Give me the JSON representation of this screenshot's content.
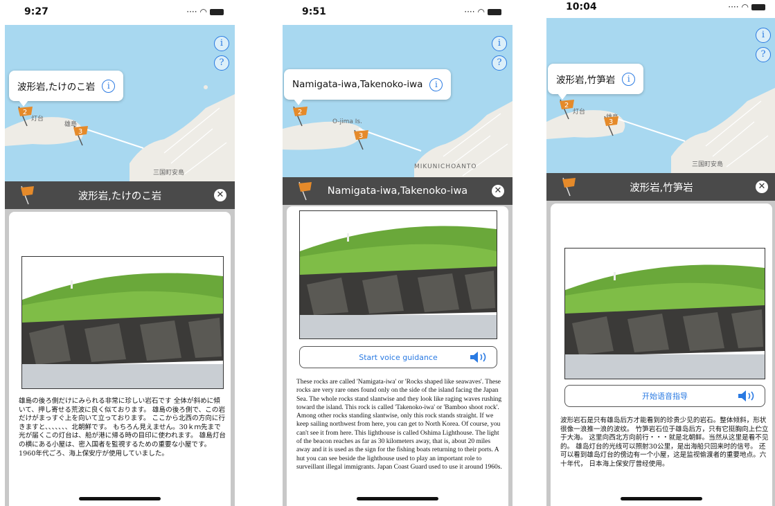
{
  "colors": {
    "water": "#a8d8f0",
    "land": "#eeece6",
    "accent": "#2a7ae2",
    "flag": "#e58a2a",
    "titlebar": "#4a4a4a"
  },
  "icons": {
    "info": "info-circle-icon",
    "help": "question-circle-icon",
    "close": "close-circle-icon",
    "speaker": "speaker-icon",
    "flag": "flag-marker-icon"
  },
  "map_controls": {
    "info_glyph": "i",
    "help_glyph": "?"
  },
  "screens": [
    {
      "time": "9:27",
      "callout_title": "波形岩,たけのこ岩",
      "map_labels": {
        "lighthouse": "灯台",
        "island": "雄島",
        "town": "三国町安島"
      },
      "flag_numbers": [
        "2",
        "3"
      ],
      "titlebar_title": "波形岩,たけのこ岩",
      "close_glyph": "✕",
      "voice_label": "",
      "description": "雄島の後ろ側だけにみられる非常に珍しい岩石です 全体が斜めに傾いて、押し寄せる荒波に良く似ております。 雄島の後ろ側で、この岩だけがまっすぐ上を向いて立っております。 ここから北西の方向に行きますと、、、、、、、北朝鮮です。 もちろん見えません。30ｋｍ先まで光が届くこの灯台は、船が港に帰る時の目印に使われます。 雄島灯台の横にある小屋は、密入国者を監視するための重要な小屋です。 1960年代ごろ、海上保安庁が使用していました。"
    },
    {
      "time": "9:51",
      "callout_title": "Namigata-iwa,Takenoko-iwa",
      "map_labels": {
        "island": "O-jima Is.",
        "town": "MIKUNICHOANTO"
      },
      "flag_numbers": [
        "2",
        "3"
      ],
      "titlebar_title": "Namigata-iwa,Takenoko-iwa",
      "close_glyph": "✕",
      "voice_label": "Start voice guidance",
      "description": "These rocks are called 'Namigata-iwa' or 'Rocks shaped like seawaves'. These rocks are very rare ones found only on the side of the island facing the Japan Sea. The whole rocks stand slantwise and they look like raging waves rushing toward the island. This rock is called 'Takenoko-iwa' or 'Bamboo shoot rock'. Among other rocks standing slantwise, only this rock stands straight. If we keep sailing northwest from here, you can get to North Korea. Of course, you can't see it from here. This lighthouse is called Oshima Lighthouse. The light of the beacon reaches as far as 30 kilometers away, that is, about 20 miles away and it is used as the sign for the fishing boats returning to their ports. A hut you can see beside the lighthouse used to play an important role to surveillant illegal immigrants. Japan Coast Guard used to use it around 1960s."
    },
    {
      "time": "10:04",
      "callout_title": "波形岩,竹笋岩",
      "map_labels": {
        "lighthouse": "灯台",
        "island": "雄島",
        "town": "三国町安島"
      },
      "flag_numbers": [
        "2",
        "3"
      ],
      "titlebar_title": "波形岩,竹笋岩",
      "close_glyph": "✕",
      "voice_label": "开始语音指导",
      "description": "波形岩石是只有雄岛后方才能看到的珍贵少见的岩石。整体倾斜，形状很像一浪推一浪的波纹。 竹笋岩石位于雄岛后方，只有它挺胸向上伫立于大海。 这里向西北方向前行・・・就是北朝鲜。当然从这里是看不见的。 雄岛灯台的光线可以照射30公里，是出海船只回来时的信号。 还可以看到雄岛灯台的傍边有一个小屋，这是监视偷渡者的重要地点。六十年代， 日本海上保安厅曾经使用。"
    }
  ]
}
